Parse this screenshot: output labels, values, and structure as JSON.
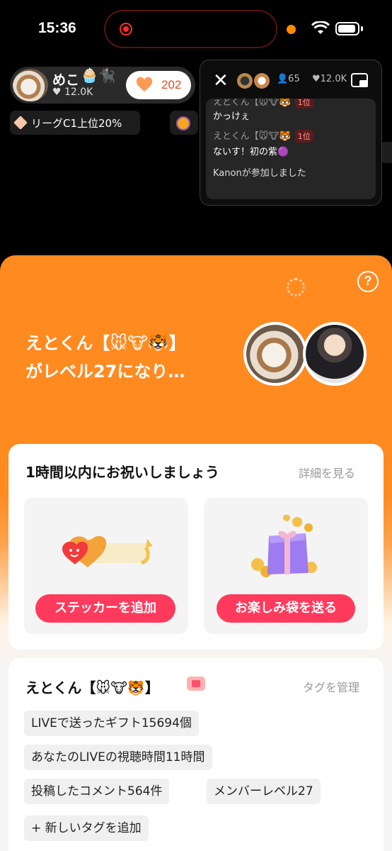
{
  "status_bar": {
    "time": "15:36"
  },
  "host": {
    "name": "めこ",
    "deco": "🧁🐈‍⬛",
    "likes": "♥ 12.0K"
  },
  "follow": {
    "count": "202"
  },
  "league": {
    "label": "リーグC1上位20%"
  },
  "chat_panel": {
    "viewers": "👤65",
    "likes": "♥12.0K",
    "messages": [
      {
        "user": "えとくん【🐭🐮🐯",
        "badge": "1位",
        "text": "かっけぇ"
      },
      {
        "user": "えとくん【🐭🐮🐯",
        "badge": "1位",
        "text": "ないす！初の紫🟣"
      }
    ],
    "join_notice": "Kanonが参加しました"
  },
  "level_up": {
    "title_line1": "えとくん【🐭🐮🐯】",
    "title_line2": "がレベル27になり…"
  },
  "celebrate_card": {
    "title": "1時間以内にお祝いしましょう",
    "details_link": "詳細を見る",
    "sticker_button": "ステッカーを追加",
    "lucky_bag_button": "お楽しみ袋を送る"
  },
  "profile_card": {
    "name": "えとくん【🐭🐮🐯】",
    "manage_tags": "タグを管理",
    "tags": [
      "LIVEで送ったギフト15694個",
      "あなたのLIVEの視聴時間11時間",
      "投稿したコメント564件",
      "メンバーレベル27",
      "+ 新しいタグを追加"
    ]
  },
  "colors": {
    "accent_orange": "#ff8a20",
    "button_pink": "#ff3a5c"
  }
}
